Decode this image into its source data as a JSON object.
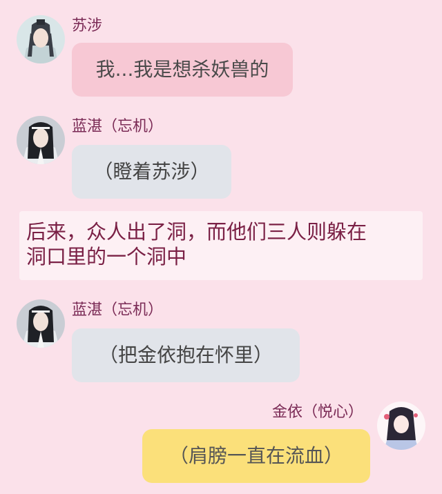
{
  "messages": [
    {
      "speaker": "苏涉",
      "text": "我...我是想杀妖兽的"
    },
    {
      "speaker": "蓝湛（忘机）",
      "text": "（瞪着苏涉）"
    },
    {
      "speaker": "蓝湛（忘机）",
      "text": "（把金依抱在怀里）"
    },
    {
      "speaker": "金依（悦心）",
      "text": "（肩膀一直在流血）"
    }
  ],
  "narration": {
    "line1": "后来，众人出了洞，而他们三人则躲在",
    "line2": "洞口里的一个洞中"
  },
  "colors": {
    "background": "#fbe1ea",
    "name": "#7a2a55",
    "bubble_pink": "#f7c8d4",
    "bubble_grey": "#e1e4ea",
    "bubble_yellow": "#fbe07a",
    "narration_bg": "#fdf0f4",
    "narration_text": "#7a2045"
  }
}
